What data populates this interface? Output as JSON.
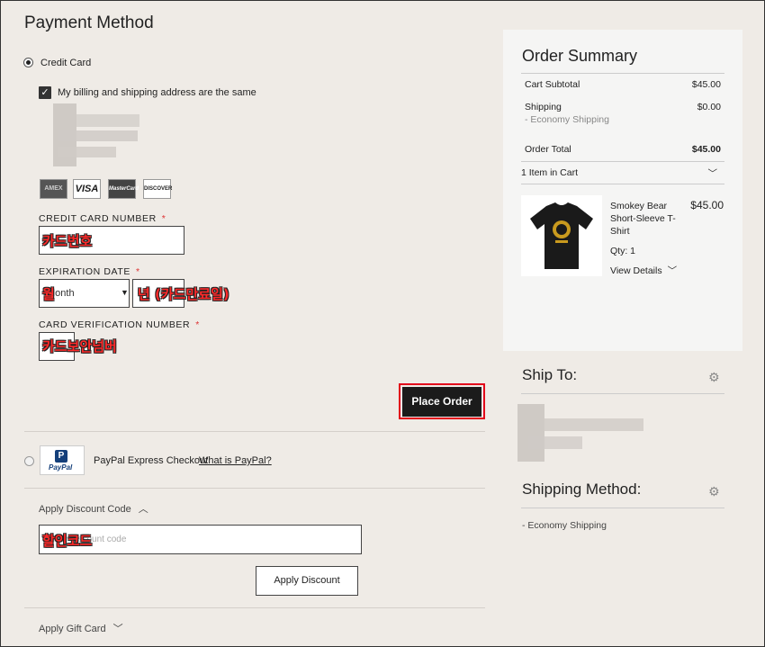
{
  "payment": {
    "title": "Payment Method",
    "credit_card_label": "Credit Card",
    "same_address_label": "My billing and shipping address are the same",
    "card_logos": [
      "AMEX",
      "VISA",
      "MasterCard",
      "DISCOVER"
    ],
    "card_number_label": "CREDIT CARD NUMBER",
    "required_mark": "*",
    "card_number_annotation": "카드번호",
    "expiration_label": "EXPIRATION DATE",
    "month_placeholder": "Month",
    "month_annotation": "월",
    "year_annotation": "년 (카드만료일)",
    "cvn_label": "CARD VERIFICATION NUMBER",
    "cvn_annotation": "카드보안넘버",
    "place_order": "Place Order",
    "paypal_label": "PayPal Express Checkout",
    "paypal_logo_text": "PayPal",
    "what_is_paypal": "What is PayPal?",
    "discount_toggle": "Apply Discount Code",
    "discount_placeholder": "Enter discount code",
    "discount_annotation": "할인코드",
    "apply_discount": "Apply Discount",
    "gift_card_toggle": "Apply Gift Card"
  },
  "summary": {
    "title": "Order Summary",
    "cart_subtotal_label": "Cart Subtotal",
    "cart_subtotal": "$45.00",
    "shipping_label": "Shipping",
    "shipping_method": "- Economy Shipping",
    "shipping_value": "$0.00",
    "order_total_label": "Order Total",
    "order_total": "$45.00",
    "items_in_cart": "1 Item in Cart",
    "item": {
      "name_line1": "Smokey Bear",
      "name_line2": "Short-Sleeve T-",
      "name_line3": "Shirt",
      "price": "$45.00",
      "qty": "Qty: 1",
      "view_details": "View Details"
    }
  },
  "ship_to": {
    "title": "Ship To:"
  },
  "shipping_method": {
    "title": "Shipping Method:",
    "value": "- Economy Shipping"
  },
  "colors": {
    "page_bg": "#efebe6",
    "annotation_red": "#ff2a2a",
    "place_order_bg": "#1b1b1b",
    "highlight_border": "#e2001a"
  }
}
